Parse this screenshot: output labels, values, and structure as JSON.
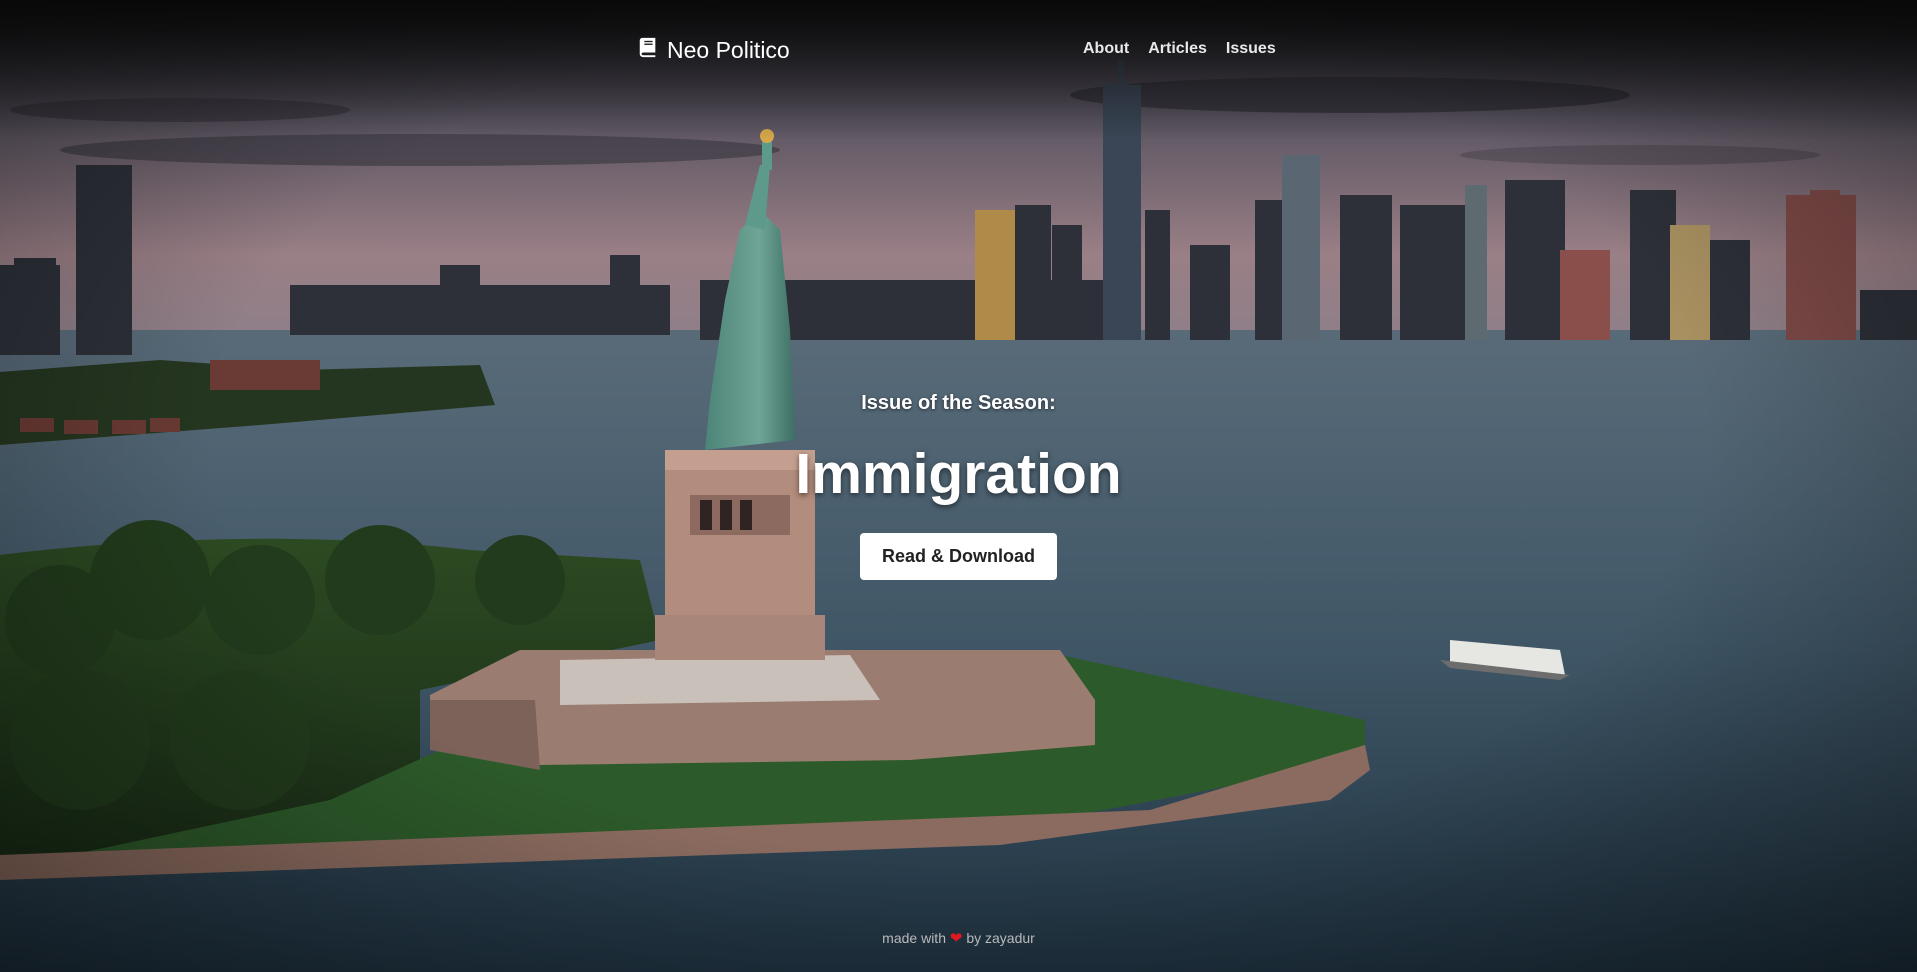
{
  "brand": {
    "name": "Neo Politico",
    "icon": "book-icon"
  },
  "nav": {
    "items": [
      "About",
      "Articles",
      "Issues"
    ]
  },
  "hero": {
    "kicker": "Issue of the Season:",
    "headline": "Immigration",
    "cta_label": "Read & Download"
  },
  "footer": {
    "prefix": "made with",
    "heart_icon": "heart-icon",
    "suffix": "by zayadur"
  },
  "colors": {
    "heart": "#e0191f",
    "button_bg": "#ffffff",
    "button_text": "#222222",
    "water": "#3c5566",
    "sky": "#7d6e7a"
  }
}
